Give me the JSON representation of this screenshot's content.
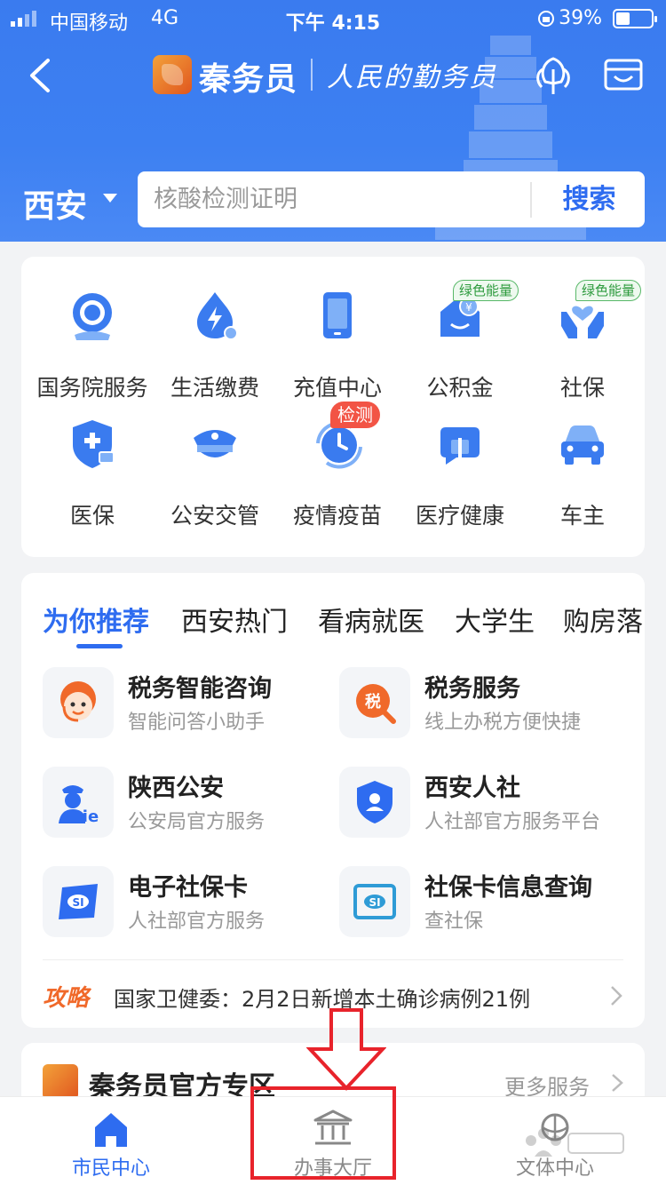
{
  "status_bar": {
    "carrier": "中国移动",
    "network": "4G",
    "time": "下午 4:15",
    "battery": "39%",
    "battery_level": 0.39
  },
  "header": {
    "brand": "秦务员",
    "slogan": "人民的勤务员",
    "city": "西安",
    "search_placeholder": "核酸检测证明",
    "search_button": "搜索"
  },
  "services": [
    {
      "label": "国务院服务",
      "icon": "state-council-icon"
    },
    {
      "label": "生活缴费",
      "icon": "utility-bill-icon"
    },
    {
      "label": "充值中心",
      "icon": "phone-recharge-icon"
    },
    {
      "label": "公积金",
      "icon": "housing-fund-icon",
      "badge": "绿色能量"
    },
    {
      "label": "社保",
      "icon": "social-security-icon",
      "badge": "绿色能量"
    },
    {
      "label": "医保",
      "icon": "medical-insurance-icon"
    },
    {
      "label": "公安交管",
      "icon": "police-cap-icon"
    },
    {
      "label": "疫情疫苗",
      "icon": "vaccine-clock-icon",
      "badge": "检测"
    },
    {
      "label": "医疗健康",
      "icon": "medical-chat-icon"
    },
    {
      "label": "车主",
      "icon": "car-icon"
    }
  ],
  "pager": {
    "pages": 3,
    "current": 1
  },
  "recommend": {
    "tabs": [
      "为你推荐",
      "西安热门",
      "看病就医",
      "大学生",
      "购房落"
    ],
    "items": [
      {
        "title": "税务智能咨询",
        "subtitle": "智能问答小助手",
        "icon": "tax-assistant-icon"
      },
      {
        "title": "税务服务",
        "subtitle": "线上办税方便快捷",
        "icon": "tax-search-icon"
      },
      {
        "title": "陕西公安",
        "subtitle": "公安局官方服务",
        "icon": "police-officer-icon"
      },
      {
        "title": "西安人社",
        "subtitle": "人社部官方服务平台",
        "icon": "shield-user-icon"
      },
      {
        "title": "电子社保卡",
        "subtitle": "人社部官方服务",
        "icon": "si-card-icon"
      },
      {
        "title": "社保卡信息查询",
        "subtitle": "查社保",
        "icon": "si-card-query-icon"
      }
    ],
    "news_tag": "攻略",
    "news_text": "国家卫健委：2月2日新增本土确诊病例21例"
  },
  "zone": {
    "title": "秦务员官方专区",
    "more": "更多服务"
  },
  "bottom_nav": [
    {
      "label": "市民中心",
      "icon": "home-icon",
      "active": true
    },
    {
      "label": "办事大厅",
      "icon": "government-hall-icon",
      "active": false
    },
    {
      "label": "文体中心",
      "icon": "culture-sports-icon",
      "active": false
    }
  ],
  "colors": {
    "primary": "#3a7bef",
    "accent_blue": "#2e6cf0",
    "orange": "#f0692a",
    "badge_red": "#f25445",
    "badge_green": "#2e9b3e",
    "annotation_red": "#e8232b"
  }
}
